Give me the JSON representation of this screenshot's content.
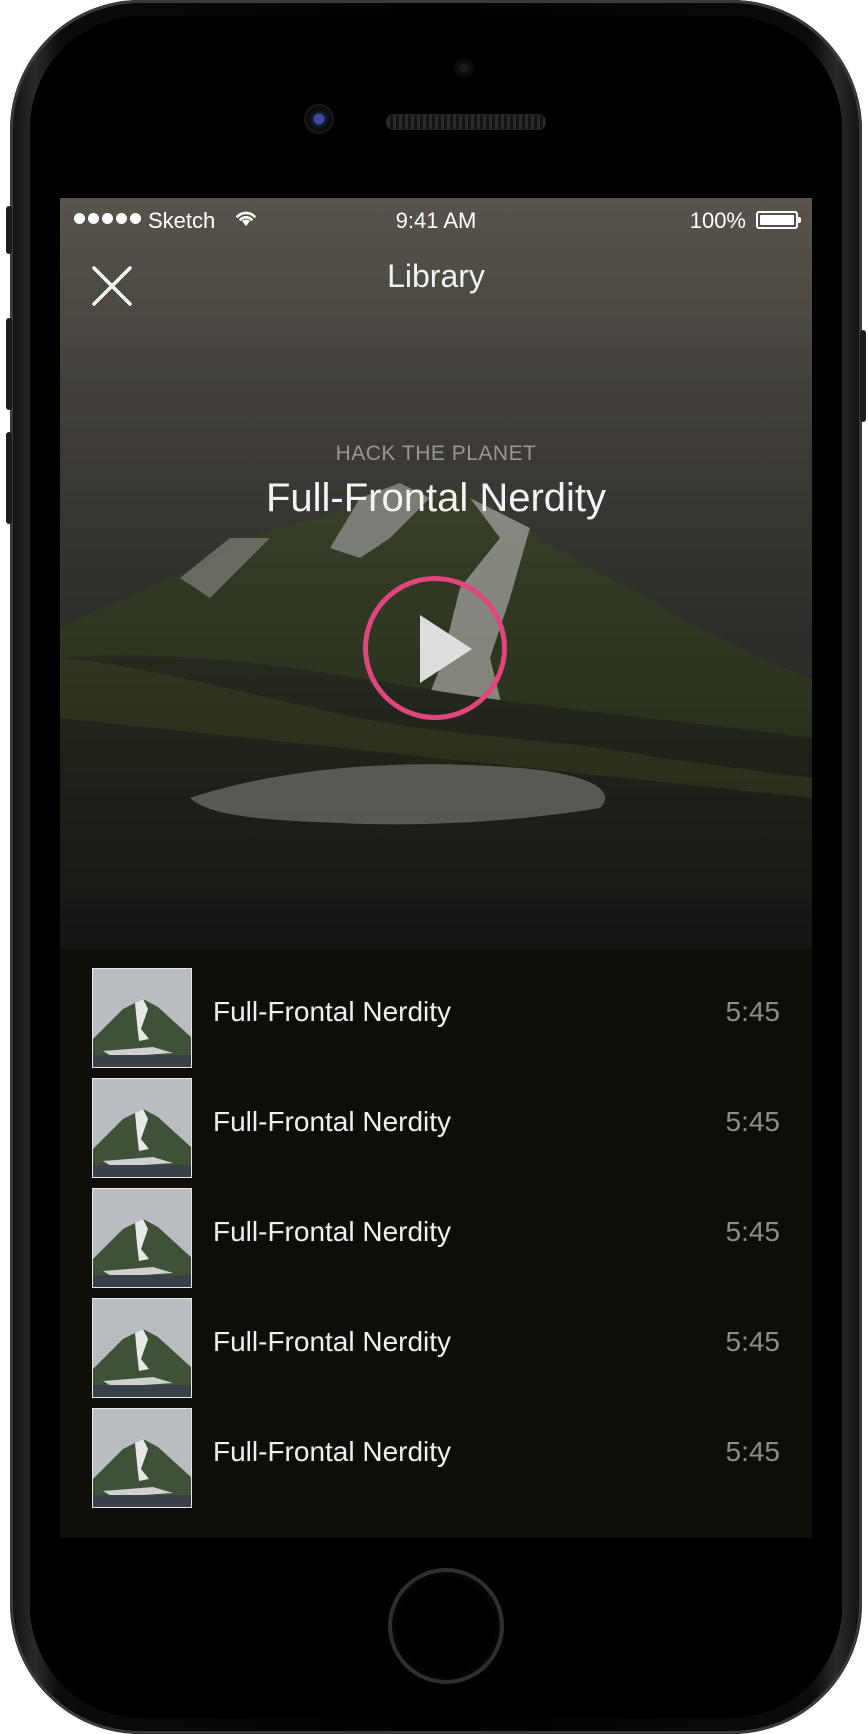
{
  "status_bar": {
    "carrier": "Sketch",
    "time": "9:41 AM",
    "battery": "100%"
  },
  "nav": {
    "title": "Library",
    "close_icon": "close-icon"
  },
  "now_playing": {
    "artist": "HACK THE PLANET",
    "title": "Full-Frontal Nerdity",
    "play_icon": "play-icon",
    "accent_color": "#e0457e"
  },
  "tracks": [
    {
      "title": "Full-Frontal Nerdity",
      "duration": "5:45"
    },
    {
      "title": "Full-Frontal Nerdity",
      "duration": "5:45"
    },
    {
      "title": "Full-Frontal Nerdity",
      "duration": "5:45"
    },
    {
      "title": "Full-Frontal Nerdity",
      "duration": "5:45"
    },
    {
      "title": "Full-Frontal Nerdity",
      "duration": "5:45"
    }
  ]
}
